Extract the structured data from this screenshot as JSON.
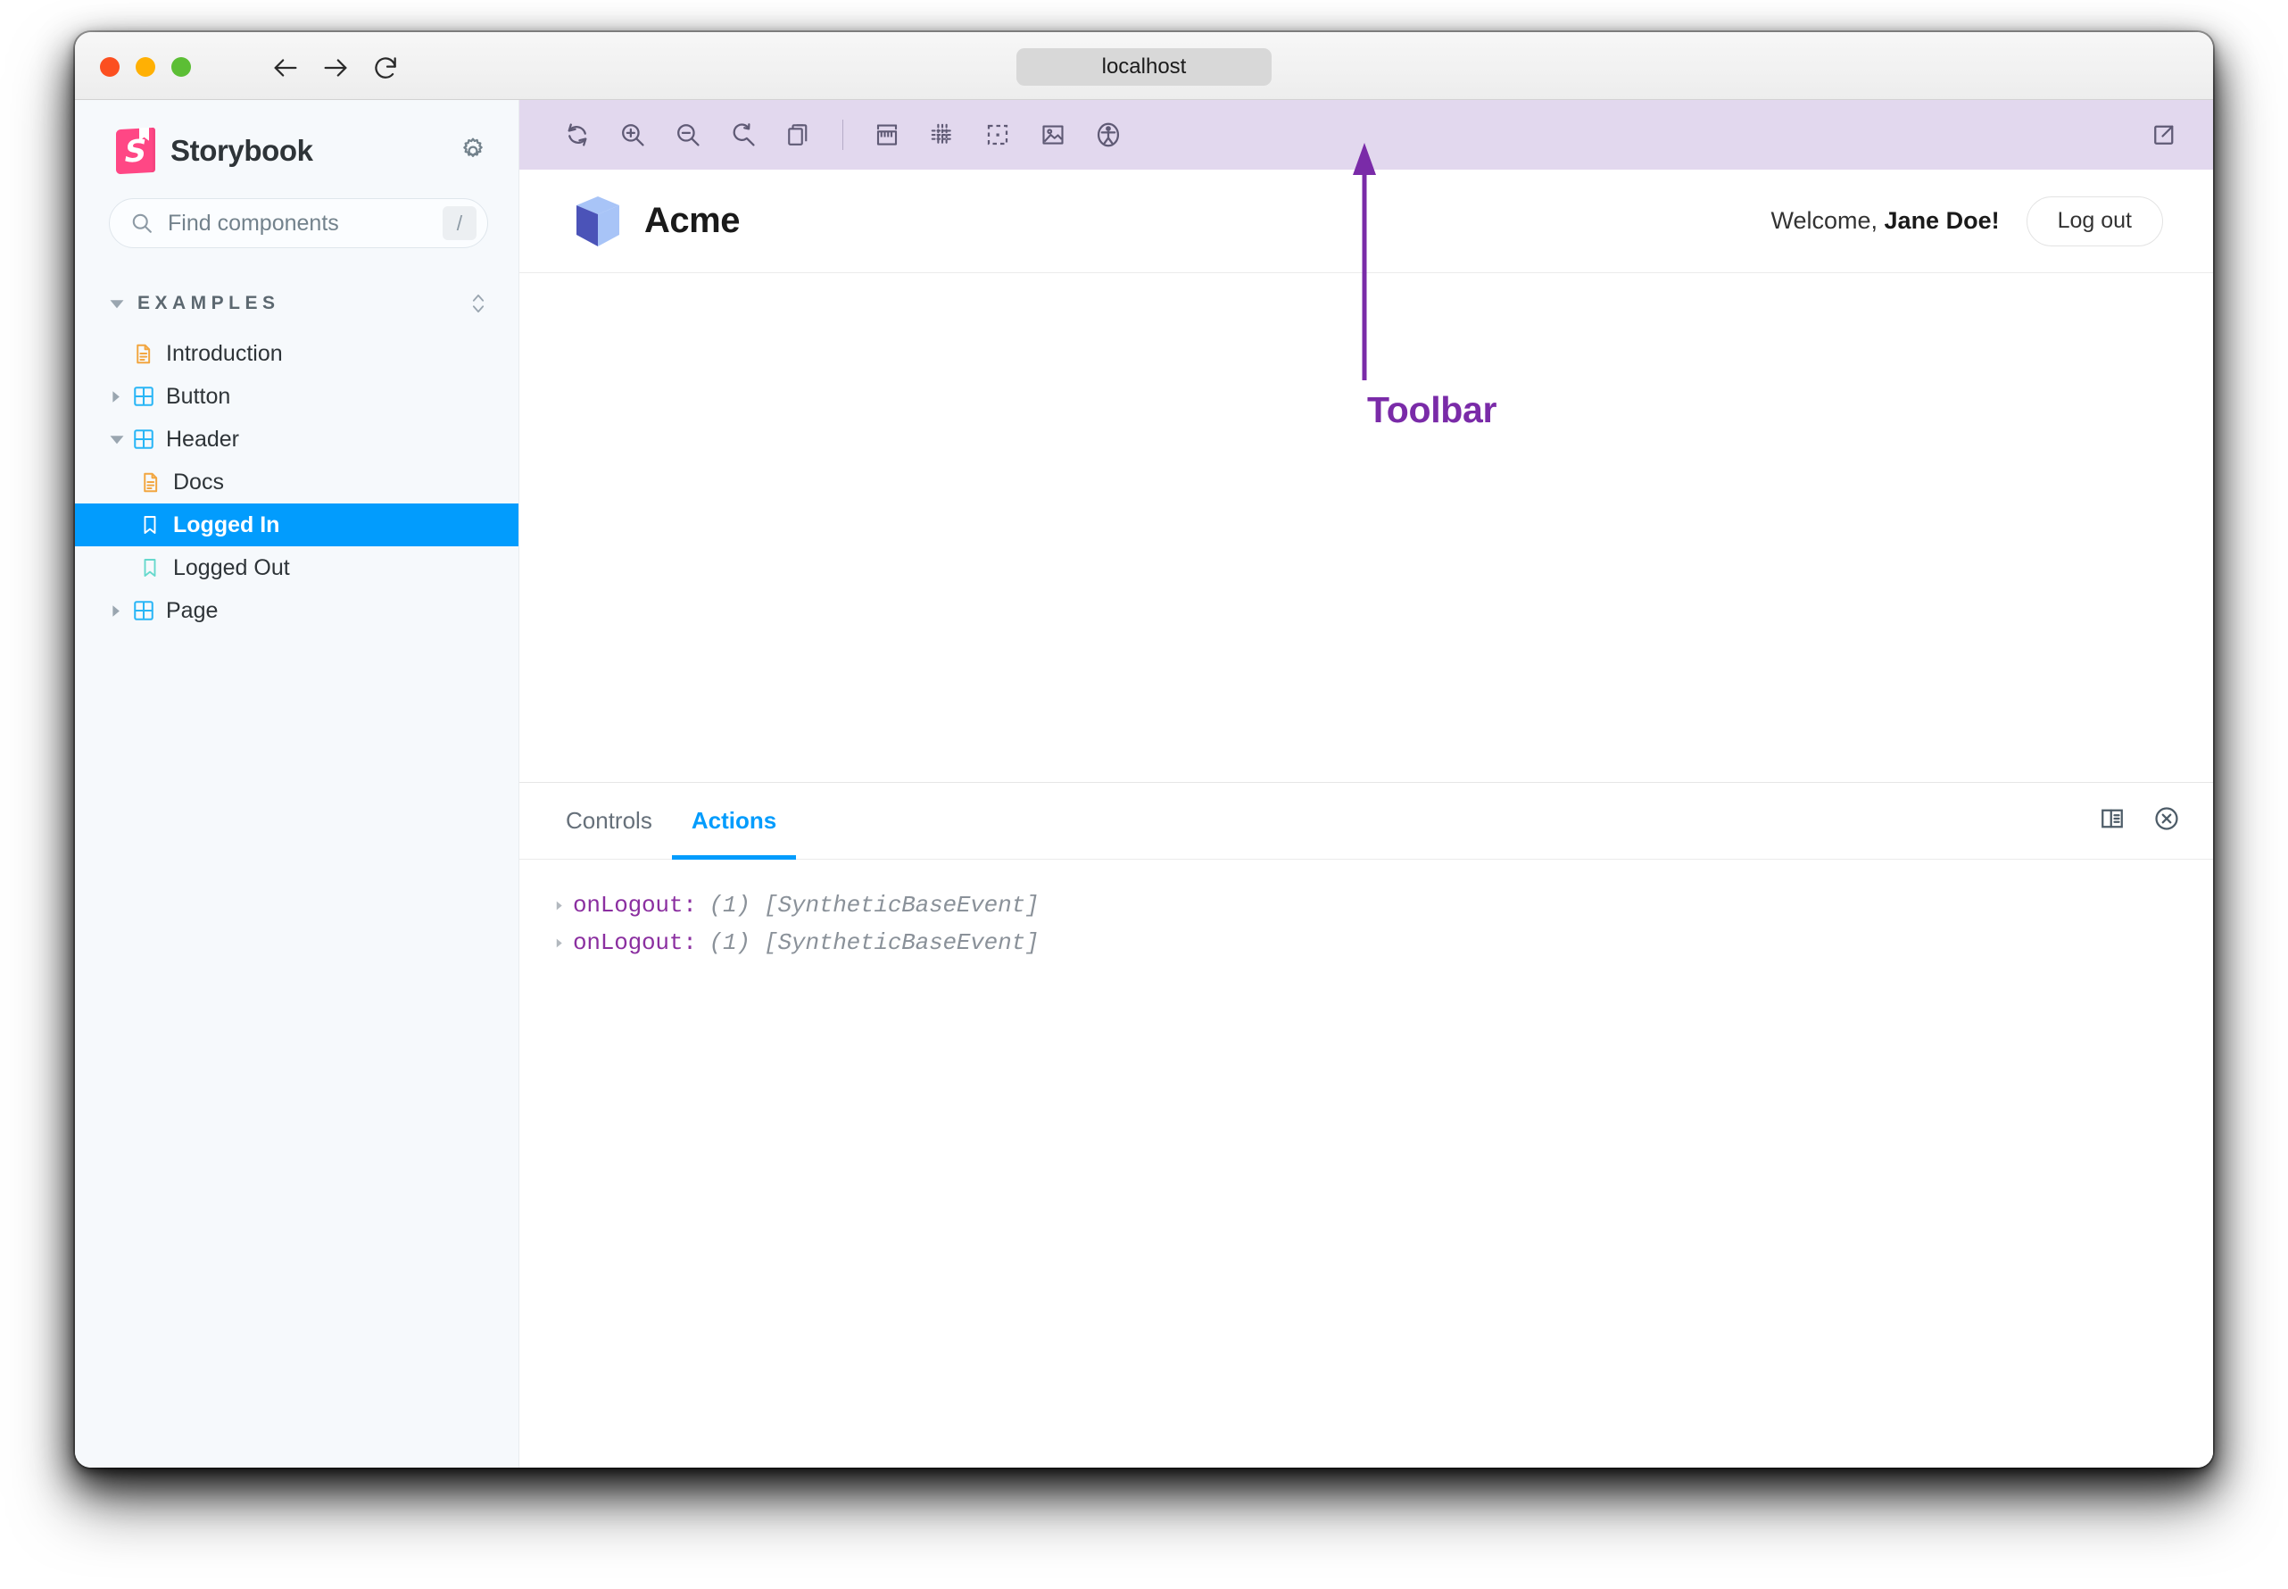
{
  "browser": {
    "url": "localhost",
    "back_icon": "arrow-left-icon",
    "forward_icon": "arrow-right-icon",
    "reload_icon": "reload-icon",
    "traffic_lights": [
      "close-red",
      "minimize-amber",
      "zoom-green"
    ]
  },
  "sidebar": {
    "brand": "Storybook",
    "settings_icon": "gear-icon",
    "search": {
      "placeholder": "Find components",
      "shortcut": "/",
      "icon": "search-icon"
    },
    "group": {
      "label": "EXAMPLES",
      "expanded": true,
      "sort_icon": "sort-icon"
    },
    "items": [
      {
        "label": "Introduction",
        "icon": "document-icon",
        "type": "docs",
        "indent": 0,
        "expandable": false,
        "selected": false
      },
      {
        "label": "Button",
        "icon": "component-icon",
        "type": "component",
        "indent": 0,
        "expandable": true,
        "expanded": false,
        "selected": false
      },
      {
        "label": "Header",
        "icon": "component-icon",
        "type": "component",
        "indent": 0,
        "expandable": true,
        "expanded": true,
        "selected": false
      },
      {
        "label": "Docs",
        "icon": "document-icon",
        "type": "docs",
        "indent": 1,
        "expandable": false,
        "selected": false
      },
      {
        "label": "Logged In",
        "icon": "story-icon",
        "type": "story",
        "indent": 1,
        "expandable": false,
        "selected": true
      },
      {
        "label": "Logged Out",
        "icon": "story-icon",
        "type": "story",
        "indent": 1,
        "expandable": false,
        "selected": false
      },
      {
        "label": "Page",
        "icon": "component-icon",
        "type": "component",
        "indent": 0,
        "expandable": true,
        "expanded": false,
        "selected": false
      }
    ]
  },
  "toolbar": {
    "background_color": "#e2d8ee",
    "icons": [
      "remount-icon",
      "zoom-in-icon",
      "zoom-out-icon",
      "zoom-reset-icon",
      "copy-icon",
      "measure-icon",
      "grid-icon",
      "outline-icon",
      "backgrounds-icon",
      "accessibility-icon"
    ],
    "open_new_tab_icon": "open-in-new-icon"
  },
  "annotation": {
    "label": "Toolbar",
    "color": "#7a2ba8",
    "arrow": "up-arrow"
  },
  "preview": {
    "logo_icon": "cube-logo-icon",
    "brand": "Acme",
    "welcome_prefix": "Welcome, ",
    "welcome_name": "Jane Doe!",
    "logout_label": "Log out"
  },
  "panel": {
    "tabs": [
      {
        "label": "Controls",
        "active": false
      },
      {
        "label": "Actions",
        "active": true
      }
    ],
    "tools": [
      "panel-position-icon",
      "close-panel-icon"
    ],
    "actions": [
      {
        "name": "onLogout:",
        "value": "(1) [SyntheticBaseEvent]",
        "expand_icon": "triangle-right-icon"
      },
      {
        "name": "onLogout:",
        "value": "(1) [SyntheticBaseEvent]",
        "expand_icon": "triangle-right-icon"
      }
    ]
  },
  "colors": {
    "accent_blue": "#029cfd",
    "storybook_pink": "#ff4785",
    "toolbar_lavender": "#e2d8ee",
    "annotation_purple": "#7a2ba8",
    "docs_orange": "#f2a640",
    "story_teal": "#66d9cd"
  }
}
